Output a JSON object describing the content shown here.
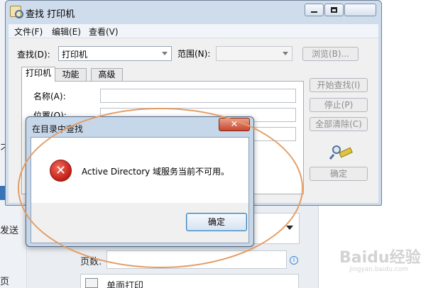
{
  "background": {
    "left_text_1": "刁",
    "left_text_2": "发送",
    "left_text_3": "页",
    "pages_label": "页数:",
    "info_icon_glyph": "i",
    "single_side_label": "单面打印"
  },
  "find_window": {
    "title": "查找 打印机",
    "menu": [
      "文件(F)",
      "编辑(E)",
      "查看(V)"
    ],
    "find_label": "查找(D):",
    "find_value": "打印机",
    "scope_label": "范围(N):",
    "browse_button": "浏览(B)...",
    "tabs": [
      "打印机",
      "功能",
      "高级"
    ],
    "fields": [
      "名称(A):",
      "位置(O):"
    ],
    "buttons": {
      "start_search": "开始查找(I)",
      "stop": "停止(P)",
      "clear_all": "全部清除(C)",
      "ok": "确定"
    }
  },
  "error_dialog": {
    "title": "在目录中查找",
    "close_glyph": "✕",
    "icon_glyph": "✕",
    "message": "Active Directory 域服务当前不可用。",
    "ok_button": "确定"
  },
  "watermark": {
    "logo": "Baidu经验",
    "url": "jingyan.baidu.com"
  },
  "colors": {
    "highlight_ellipse": "#e39d66",
    "error_icon": "#c21e14",
    "title_bar": "#cfdcec"
  }
}
